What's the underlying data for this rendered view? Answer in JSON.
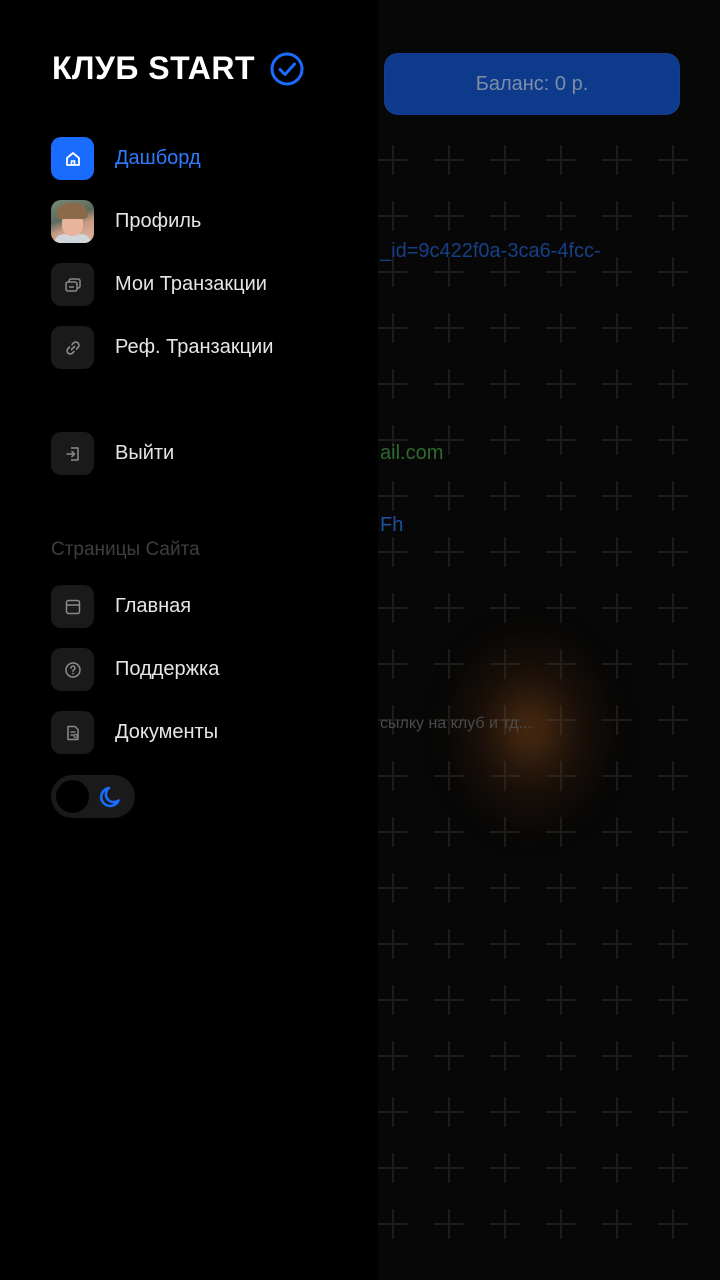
{
  "brand": {
    "title": "КЛУБ START",
    "verified_icon": "verified-check-icon",
    "accent": "#1a6cff"
  },
  "balance": {
    "label": "Баланс: 0 р."
  },
  "nav": {
    "items": [
      {
        "id": "dashboard",
        "label": "Дашборд",
        "icon": "home-icon",
        "active": true
      },
      {
        "id": "profile",
        "label": "Профиль",
        "icon": "avatar",
        "active": false
      },
      {
        "id": "my-transactions",
        "label": "Мои Транзакции",
        "icon": "transactions-icon",
        "active": false
      },
      {
        "id": "ref-transactions",
        "label": "Реф. Транзакции",
        "icon": "link-icon",
        "active": false
      }
    ],
    "logout": {
      "label": "Выйти",
      "icon": "logout-icon"
    }
  },
  "site_pages": {
    "title": "Страницы Сайта",
    "items": [
      {
        "id": "home",
        "label": "Главная",
        "icon": "window-icon"
      },
      {
        "id": "support",
        "label": "Поддержка",
        "icon": "help-circle-icon"
      },
      {
        "id": "documents",
        "label": "Документы",
        "icon": "document-icon"
      }
    ]
  },
  "theme_toggle": {
    "mode": "dark",
    "icon": "moon-icon"
  },
  "background": {
    "ref_link_fragment": "_id=9c422f0a-3ca6-4fcc-",
    "email_fragment": "ail.com",
    "code_fragment": "Fh",
    "description_fragment": "сылку на клуб и тд..."
  }
}
